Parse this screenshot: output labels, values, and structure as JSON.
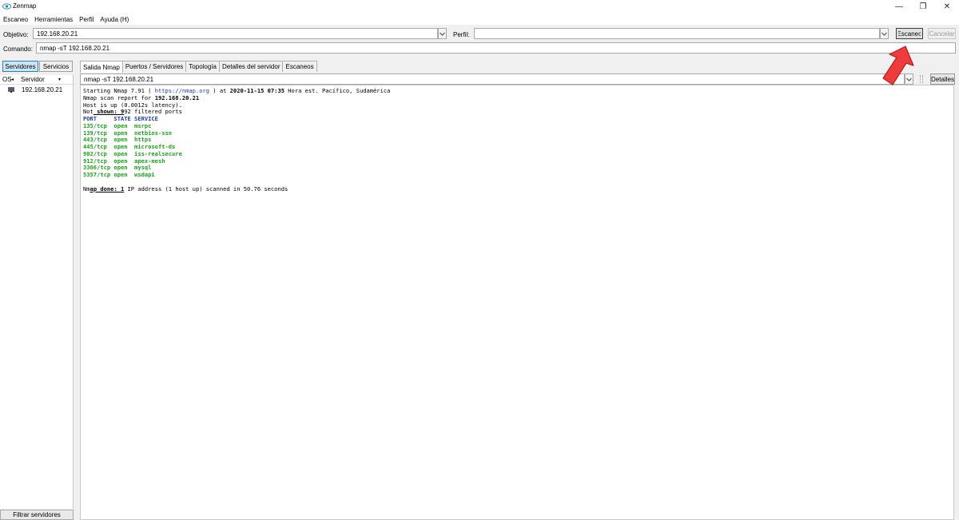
{
  "window": {
    "title": "Zenmap",
    "controls": [
      "—",
      "❐",
      "✕"
    ]
  },
  "menu": [
    "Escaneo",
    "Herramientas",
    "Perfil",
    "Ayuda (H)"
  ],
  "toolbar": {
    "target_label": "Objetivo:",
    "target_value": "192.168.20.21",
    "profile_label": "Perfil:",
    "profile_value": "",
    "scan_button": "Escaneo",
    "cancel_button": "Cancelar",
    "command_label": "Comando:",
    "command_value": "nmap -sT 192.168.20.21"
  },
  "left_pane": {
    "hosts_tab": "Servidores",
    "services_tab": "Servicios",
    "col_os": "OS",
    "col_host": "Servidor",
    "hosts": [
      "192.168.20.21"
    ],
    "filter_button": "Filtrar servidores"
  },
  "tabs": [
    "Salida Nmap",
    "Puertos / Servidores",
    "Topología",
    "Detalles del servidor",
    "Escaneos"
  ],
  "output_selector": {
    "value": "nmap -sT 192.168.20.21",
    "details_button": "Detalles"
  },
  "output": {
    "start_pre": "Starting Nmap 7.91 ( ",
    "start_link": "https://nmap.org",
    "start_mid": " ) at ",
    "start_date": "2020-11-15 07:35",
    "start_post": " Hora est. Pacífico, Sudamérica",
    "report_pre": "Nmap scan report for ",
    "report_ip": "192.168.20.21",
    "host_up": "Host is up (0.0012s latency).",
    "not_shown_a": "Not",
    "not_shown_b": " shown: 9",
    "not_shown_c": "92 filtered ports",
    "port_header": "PORT     STATE SERVICE",
    "ports": [
      "135/tcp  open  msrpc",
      "139/tcp  open  netbios-ssn",
      "443/tcp  open  https",
      "445/tcp  open  microsoft-ds",
      "902/tcp  open  iss-realsecure",
      "912/tcp  open  apex-mesh",
      "3306/tcp open  mysql",
      "5357/tcp open  wsdapi"
    ],
    "done_a": "Nm",
    "done_b": "ap done: 1",
    "done_c": " IP address (1 host up) scanned in 50.76 seconds"
  },
  "colors": {
    "accent": "#2a7fc4",
    "port_green": "#1aa31a",
    "link_blue": "#1f3fa8",
    "arrow_red": "#ee3b3b"
  },
  "icons": [
    "zenmap-eye-icon",
    "host-monitor-icon",
    "chevron-down-icon",
    "sort-arrow-icon",
    "red-pointer-arrow-icon"
  ]
}
